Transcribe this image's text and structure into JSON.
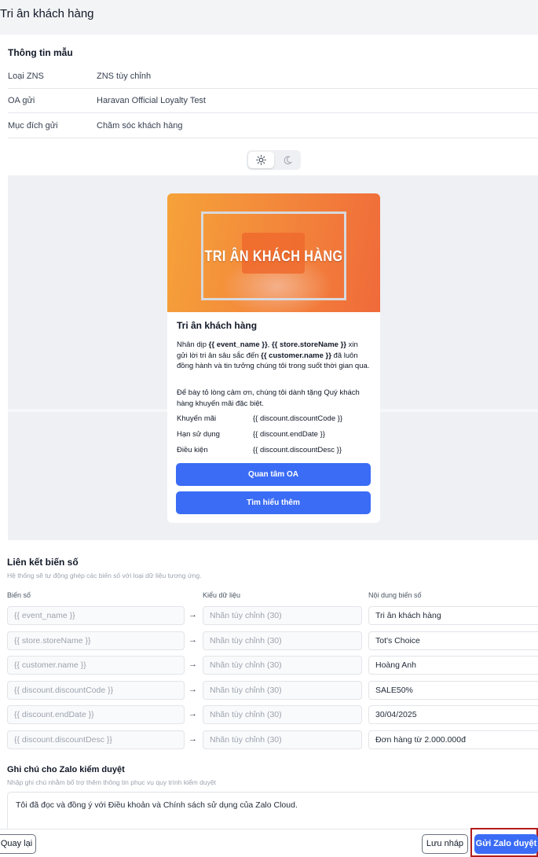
{
  "page": {
    "title": "Tri ân khách hàng"
  },
  "template_info": {
    "title": "Thông tin mẫu",
    "rows": [
      {
        "label": "Loại ZNS",
        "value": "ZNS tùy chỉnh"
      },
      {
        "label": "OA gửi",
        "value": "Haravan Official Loyalty Test"
      },
      {
        "label": "Mục đích gửi",
        "value": "Chăm sóc khách hàng"
      }
    ]
  },
  "theme_toggle": {
    "light_icon": "sun-icon",
    "dark_icon": "moon-icon",
    "selected": "light"
  },
  "preview": {
    "banner_text": "TRI ÂN KHÁCH HÀNG",
    "title": "Tri ân khách hàng",
    "para1": {
      "t1": "Nhân dịp ",
      "b1": "{{ event_name }}",
      "t2": ", ",
      "b2": "{{ store.storeName }}",
      "t3": " xin gửi lời tri ân sâu sắc đến ",
      "b3": "{{ customer.name }}",
      "t4": " đã luôn đồng hành và tin tưởng chúng tôi trong suốt thời gian qua."
    },
    "para2": "Để bày tỏ lòng cảm ơn, chúng tôi dành tặng Quý khách hàng khuyến mãi đặc biệt.",
    "table": [
      {
        "label": "Khuyến mãi",
        "value": "{{ discount.discountCode }}"
      },
      {
        "label": "Hạn sử dụng",
        "value": "{{ discount.endDate }}"
      },
      {
        "label": "Điều kiện",
        "value": "{{ discount.discountDesc }}"
      }
    ],
    "buttons": [
      "Quan tâm OA",
      "Tìm hiểu thêm"
    ]
  },
  "variable_link": {
    "title": "Liên kết biến số",
    "subtitle": "Hệ thống sẽ tự động ghép các biến số với loại dữ liệu tương ứng.",
    "col_variable": "Biến số",
    "col_type": "Kiểu dữ liệu",
    "col_content": "Nội dung biến số",
    "arrow": "→",
    "rows": [
      {
        "variable": "{{ event_name }}",
        "type": "Nhãn tùy chỉnh (30)",
        "content": "Tri ân khách hàng"
      },
      {
        "variable": "{{ store.storeName }}",
        "type": "Nhãn tùy chỉnh (30)",
        "content": "Tot's Choice"
      },
      {
        "variable": "{{ customer.name }}",
        "type": "Nhãn tùy chỉnh (30)",
        "content": "Hoàng Anh"
      },
      {
        "variable": "{{ discount.discountCode }}",
        "type": "Nhãn tùy chỉnh (30)",
        "content": "SALE50%"
      },
      {
        "variable": "{{ discount.endDate }}",
        "type": "Nhãn tùy chỉnh (30)",
        "content": "30/04/2025"
      },
      {
        "variable": "{{ discount.discountDesc }}",
        "type": "Nhãn tùy chỉnh (30)",
        "content": "Đơn hàng từ 2.000.000đ"
      }
    ]
  },
  "review_note": {
    "title": "Ghi chú cho Zalo kiểm duyệt",
    "subtitle": "Nhập ghi chú nhằm bổ trợ thêm thông tin phục vụ quy trình kiểm duyệt",
    "value": "Tôi đã đọc và đồng ý với Điều khoản và Chính sách sử dụng của Zalo Cloud."
  },
  "footer": {
    "back_label": "Quay lại",
    "draft_label": "Lưu nháp",
    "submit_label": "Gửi Zalo duyệt"
  },
  "colors": {
    "primary": "#3b6cf6",
    "highlight_border": "#b11b1b"
  }
}
